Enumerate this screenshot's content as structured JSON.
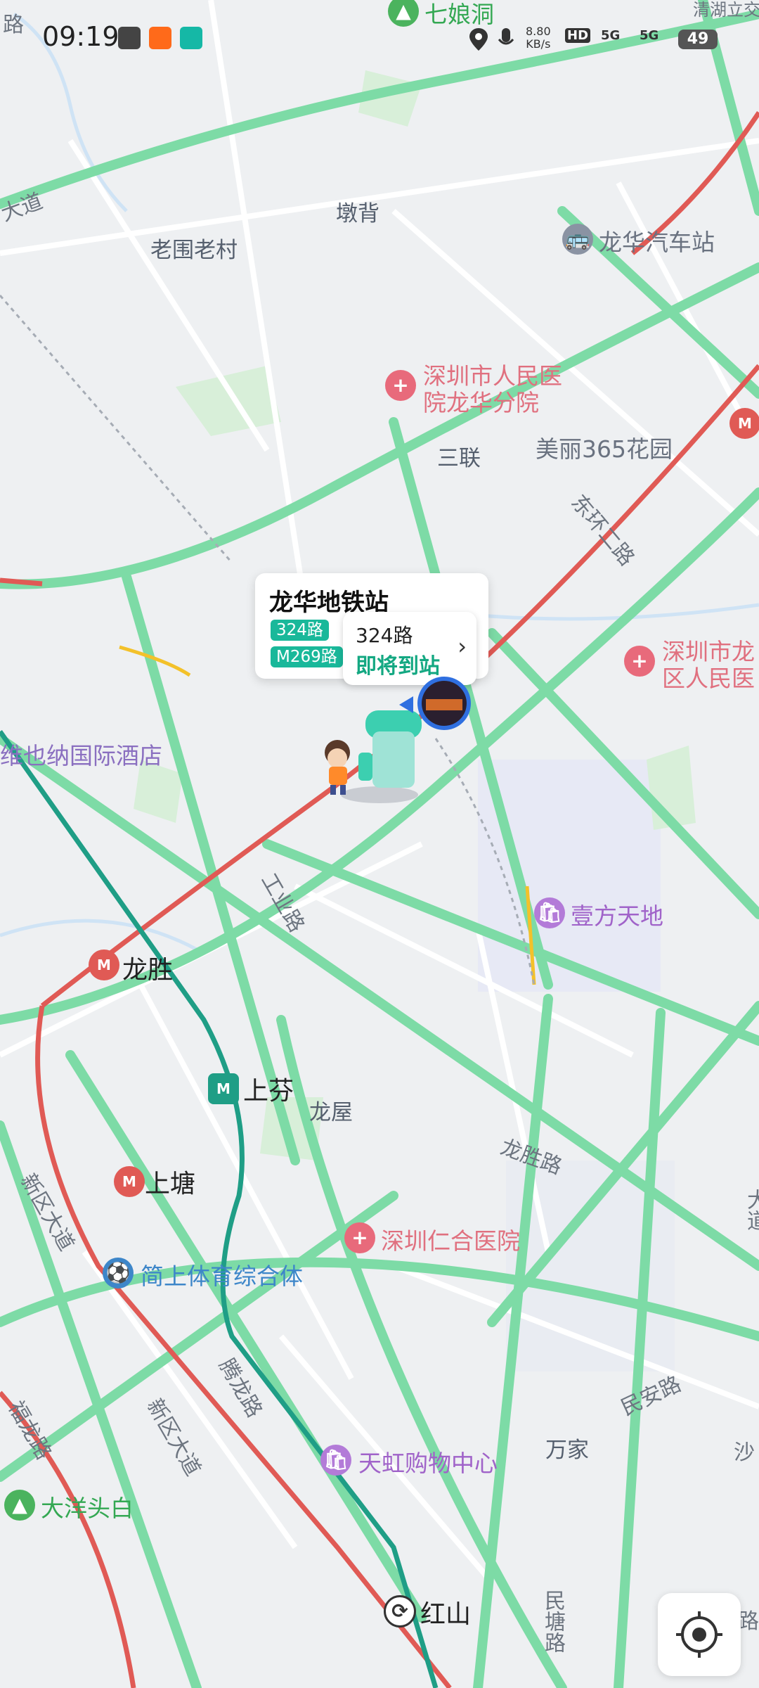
{
  "status_bar": {
    "time": "09:19",
    "net_speed_value": "8.80",
    "net_speed_unit": "KB/s",
    "hd_label": "HD",
    "signal_1": "5G",
    "signal_2": "5G",
    "battery": "49"
  },
  "map_labels": {
    "qiniangdong": "七娘洞",
    "qinghu": "清湖立交",
    "dunbei": "墩背",
    "laoweilaocun": "老围老村",
    "longhua_bus_station": "龙华汽车站",
    "hospital_people_1": "深圳市人民医",
    "hospital_people_2": "院龙华分院",
    "sanlian": "三联",
    "meili365": "美丽365花园",
    "dongwan_road": "东环二路",
    "district_hospital_1": "深圳市龙",
    "district_hospital_2": "区人民医",
    "vienna_hotel": "维也纳国际酒店",
    "gongye_road": "工业路",
    "yifang": "壹方天地",
    "longsheng": "龙胜",
    "shangfen": "上芬",
    "longwu": "龙屋",
    "longsheng_road": "龙胜路",
    "xinqu_avenue_1": "新区大道",
    "shangtang": "上塘",
    "renhe_hospital": "深圳仁合医院",
    "jianshang_sports": "简上体育综合体",
    "tenglong_road": "腾龙路",
    "fulong_road": "福龙路",
    "xinqu_avenue_2": "新区大道",
    "minan_road": "民安路",
    "wanjia": "万家",
    "tianhong": "天虹购物中心",
    "dayangtoubai": "大洋头白",
    "hongshan": "红山",
    "mintang_road": "民塘路",
    "road_1": "路",
    "road_2": "大道",
    "road_3": "路",
    "right_edge_1": "沙",
    "right_edge_2": "大道"
  },
  "station_popup": {
    "title": "龙华地铁站",
    "routes": [
      "324路",
      "M269路"
    ]
  },
  "arrival_card": {
    "route": "324路",
    "status": "即将到站"
  },
  "colors": {
    "road_green": "#7ddba6",
    "metro_red": "#e05a55",
    "metro_teal": "#1f9e86",
    "water": "#cfe3f5",
    "accent": "#19b89a"
  }
}
